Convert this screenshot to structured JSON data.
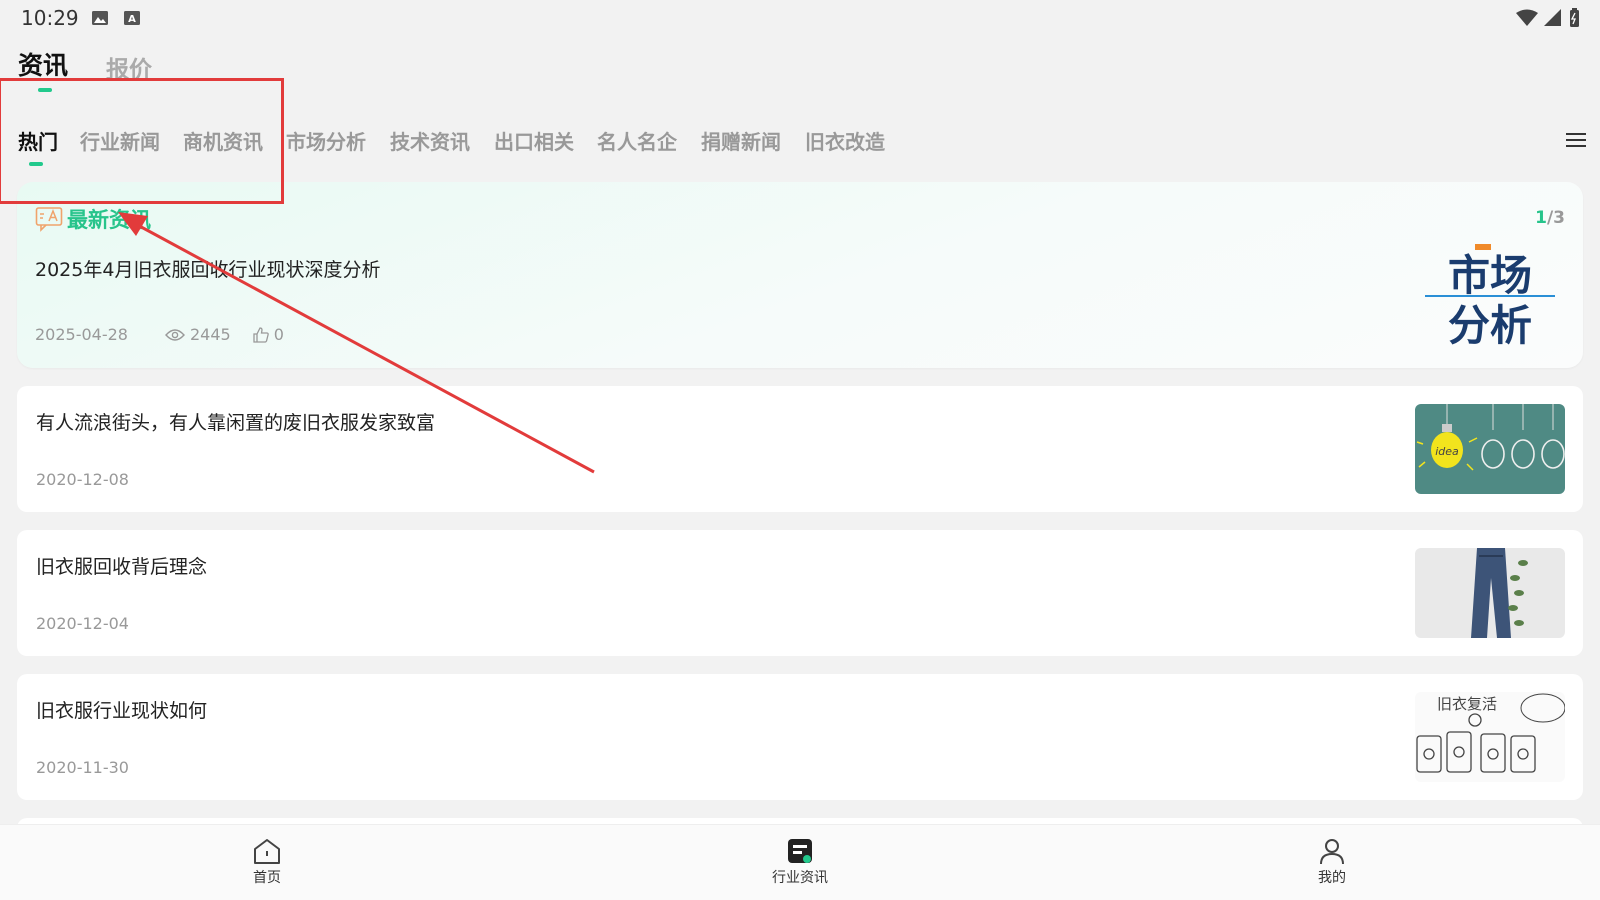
{
  "status_bar": {
    "time": "10:29"
  },
  "top_tabs": [
    {
      "label": "资讯",
      "active": true
    },
    {
      "label": "报价",
      "active": false
    }
  ],
  "categories": [
    "热门",
    "行业新闻",
    "商机资讯",
    "市场分析",
    "技术资讯",
    "出口相关",
    "名人名企",
    "捐赠新闻",
    "旧衣改造"
  ],
  "featured": {
    "badge": "最新资讯",
    "pager_current": "1",
    "pager_total": "/3",
    "title": "2025年4月旧衣服回收行业现状深度分析",
    "date": "2025-04-28",
    "views": "2445",
    "likes": "0",
    "thumb_text_top": "市场",
    "thumb_text_bottom": "分析"
  },
  "articles": [
    {
      "title": "有人流浪街头，有人靠闲置的废旧衣服发家致富",
      "date": "2020-12-08",
      "thumb": "lightbulb-image",
      "thumb_text": "idea"
    },
    {
      "title": "旧衣服回收背后理念",
      "date": "2020-12-04",
      "thumb": "jeans-image"
    },
    {
      "title": "旧衣服行业现状如何",
      "date": "2020-11-30",
      "thumb": "recycle-bins-image",
      "thumb_text": "旧衣复活"
    }
  ],
  "bottom_nav": [
    {
      "label": "首页",
      "icon": "home-icon",
      "active": false
    },
    {
      "label": "行业资讯",
      "icon": "news-icon",
      "active": true
    },
    {
      "label": "我的",
      "icon": "profile-icon",
      "active": false
    }
  ],
  "colors": {
    "accent": "#22c98c",
    "annotation": "#e23b3b"
  }
}
